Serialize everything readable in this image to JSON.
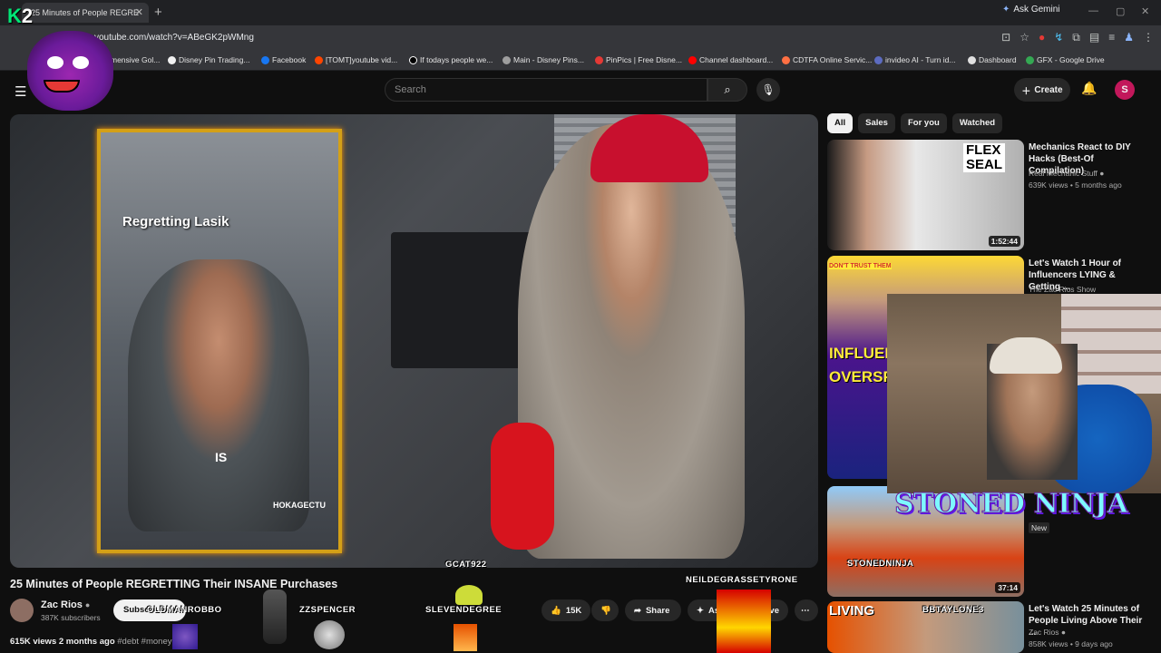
{
  "browser": {
    "tab_title": "25 Minutes of People REGRE",
    "url": "youtube.com/watch?v=ABeGK2pWMng",
    "ask_gemini": "Ask Gemini",
    "bookmarks": [
      {
        "label": "mensive Gol...",
        "color": "#fbbc04"
      },
      {
        "label": "Disney Pin Trading...",
        "color": "#f1f1f1"
      },
      {
        "label": "Facebook",
        "color": "#1877f2"
      },
      {
        "label": "[TOMT]youtube vid...",
        "color": "#ff4500"
      },
      {
        "label": "If todays people we...",
        "color": "#000000"
      },
      {
        "label": "Main - Disney Pins...",
        "color": "#9e9e9e"
      },
      {
        "label": "PinPics | Free Disne...",
        "color": "#e53935"
      },
      {
        "label": "Channel dashboard...",
        "color": "#ff0000"
      },
      {
        "label": "CDTFA Online Servic...",
        "color": "#ff7043"
      },
      {
        "label": "invideo AI - Turn id...",
        "color": "#5c6bc0"
      },
      {
        "label": "Dashboard",
        "color": "#e0e0e0"
      },
      {
        "label": "GFX - Google Drive",
        "color": "#34a853"
      }
    ]
  },
  "youtube": {
    "search_placeholder": "Search",
    "create_label": "Create",
    "avatar_letter": "S"
  },
  "video": {
    "title": "25 Minutes of People REGRETTING Their INSANE Purchases",
    "tiktok_caption": "Regretting Lasik",
    "tiktok_word": "IS",
    "tiktok_user": "HOKAGECTU",
    "channel_name": "Zac Rios",
    "channel_subs": "387K subscribers",
    "subscribe_label": "Subsc",
    "likes": "15K",
    "share_label": "Share",
    "ask_label": "As",
    "save_label": "ave",
    "views_time": "615K views  2 months ago",
    "tags": "#debt #money    ance"
  },
  "overlays": {
    "names": [
      "GCAT922",
      "NEILDEGRASSETYRONE",
      "OLDMANROBBO",
      "ZZSPENCER",
      "SLEVENDEGREE",
      "STONEDNINJA",
      "BBTAYLONE3"
    ],
    "banner": "STONED NINJA",
    "logo": "K2"
  },
  "sidebar": {
    "chips": [
      "All",
      "Sales",
      "For you",
      "Watched"
    ],
    "recommendations": [
      {
        "title": "Mechanics React to DIY Hacks (Best-Of Compilation)",
        "channel": "Real Mechanic Stuff",
        "meta": "639K views • 5 months ago",
        "duration": "1:52:44"
      },
      {
        "title": "Let's Watch 1 Hour of Influencers LYING & Getting ...",
        "channel": "The Zac Rios Show",
        "meta": "",
        "duration": ""
      },
      {
        "title": "",
        "channel": "",
        "meta": "New",
        "duration": "37:14"
      },
      {
        "title": "Let's Watch 25 Minutes of People Living Above Their ...",
        "channel": "Zac Rios",
        "meta": "858K views • 9 days ago",
        "duration": ""
      }
    ]
  },
  "thumb_text": {
    "flex": "FLEX",
    "seal": "SEAL",
    "influencer": "INFLUENC",
    "overspend": "OVERSPEN",
    "dont_trust": "DON'T TRUST THEM",
    "living": "LIVING"
  }
}
